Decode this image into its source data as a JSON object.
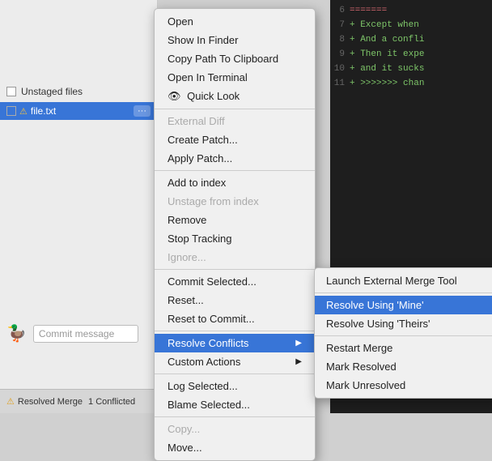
{
  "background": {
    "code_lines": [
      {
        "num": "6",
        "content": "=======",
        "type": "conflict"
      },
      {
        "num": "7",
        "content": "+ Except when",
        "type": "add"
      },
      {
        "num": "8",
        "content": "+ And a confli",
        "type": "add"
      },
      {
        "num": "9",
        "content": "+ Then it expe",
        "type": "add"
      },
      {
        "num": "10",
        "content": "+ and it sucks",
        "type": "add"
      },
      {
        "num": "11",
        "content": "+ >>>>>>> chan",
        "type": "add"
      }
    ]
  },
  "sidebar": {
    "unstaged_label": "Unstaged files",
    "file_name": "file.txt",
    "commit_placeholder": "Commit message",
    "status_label": "Resolved Merge",
    "conflict_label": "1 Conflicted"
  },
  "context_menu": {
    "items": [
      {
        "id": "open",
        "label": "Open",
        "disabled": false,
        "submenu": false
      },
      {
        "id": "show-in-finder",
        "label": "Show In Finder",
        "disabled": false,
        "submenu": false
      },
      {
        "id": "copy-path",
        "label": "Copy Path To Clipboard",
        "disabled": false,
        "submenu": false
      },
      {
        "id": "open-in-terminal",
        "label": "Open In Terminal",
        "disabled": false,
        "submenu": false
      },
      {
        "id": "quick-look",
        "label": "Quick Look",
        "disabled": false,
        "submenu": false,
        "icon": true
      },
      {
        "id": "sep1",
        "type": "separator"
      },
      {
        "id": "external-diff",
        "label": "External Diff",
        "disabled": true,
        "submenu": false
      },
      {
        "id": "create-patch",
        "label": "Create Patch...",
        "disabled": false,
        "submenu": false
      },
      {
        "id": "apply-patch",
        "label": "Apply Patch...",
        "disabled": false,
        "submenu": false
      },
      {
        "id": "sep2",
        "type": "separator"
      },
      {
        "id": "add-to-index",
        "label": "Add to index",
        "disabled": false,
        "submenu": false
      },
      {
        "id": "unstage-from-index",
        "label": "Unstage from index",
        "disabled": true,
        "submenu": false
      },
      {
        "id": "remove",
        "label": "Remove",
        "disabled": false,
        "submenu": false
      },
      {
        "id": "stop-tracking",
        "label": "Stop Tracking",
        "disabled": false,
        "submenu": false
      },
      {
        "id": "ignore",
        "label": "Ignore...",
        "disabled": true,
        "submenu": false
      },
      {
        "id": "sep3",
        "type": "separator"
      },
      {
        "id": "commit-selected",
        "label": "Commit Selected...",
        "disabled": false,
        "submenu": false
      },
      {
        "id": "reset",
        "label": "Reset...",
        "disabled": false,
        "submenu": false
      },
      {
        "id": "reset-to-commit",
        "label": "Reset to Commit...",
        "disabled": false,
        "submenu": false
      },
      {
        "id": "sep4",
        "type": "separator"
      },
      {
        "id": "resolve-conflicts",
        "label": "Resolve Conflicts",
        "disabled": false,
        "submenu": true,
        "active": true
      },
      {
        "id": "custom-actions",
        "label": "Custom Actions",
        "disabled": false,
        "submenu": true
      },
      {
        "id": "sep5",
        "type": "separator"
      },
      {
        "id": "log-selected",
        "label": "Log Selected...",
        "disabled": false,
        "submenu": false
      },
      {
        "id": "blame-selected",
        "label": "Blame Selected...",
        "disabled": false,
        "submenu": false
      },
      {
        "id": "sep6",
        "type": "separator"
      },
      {
        "id": "copy",
        "label": "Copy...",
        "disabled": true,
        "submenu": false
      },
      {
        "id": "move",
        "label": "Move...",
        "disabled": false,
        "submenu": false
      }
    ]
  },
  "submenu": {
    "items": [
      {
        "id": "launch-merge-tool",
        "label": "Launch External Merge Tool",
        "active": false
      },
      {
        "id": "sep1",
        "type": "separator"
      },
      {
        "id": "resolve-mine",
        "label": "Resolve Using 'Mine'",
        "active": true
      },
      {
        "id": "resolve-theirs",
        "label": "Resolve Using 'Theirs'",
        "active": false
      },
      {
        "id": "sep2",
        "type": "separator"
      },
      {
        "id": "restart-merge",
        "label": "Restart Merge",
        "active": false
      },
      {
        "id": "mark-resolved",
        "label": "Mark Resolved",
        "active": false
      },
      {
        "id": "mark-unresolved",
        "label": "Mark Unresolved",
        "active": false
      }
    ]
  }
}
